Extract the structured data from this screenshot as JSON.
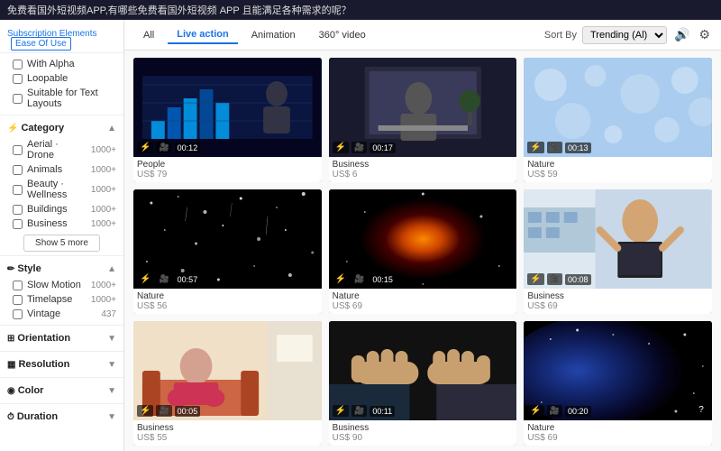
{
  "topbar": {
    "title": "免费看国外短视频APP,有哪些免费看国外短视频 APP 且能满足各种需求的呢？",
    "breadcrumb1": "Subscription Elements",
    "breadcrumb2": "Ease Of Use"
  },
  "sidebar": {
    "topLinks": [
      "With Alpha",
      "Loopable",
      "Suitable for Text Layouts"
    ],
    "sections": [
      {
        "id": "category",
        "label": "Category",
        "icon": "☰",
        "expanded": true,
        "items": [
          {
            "label": "Aerial · Drone",
            "count": "1000+"
          },
          {
            "label": "Animals",
            "count": "1000+"
          },
          {
            "label": "Beauty · Wellness",
            "count": "1000+"
          },
          {
            "label": "Buildings",
            "count": "1000+"
          },
          {
            "label": "Business",
            "count": "1000+"
          }
        ],
        "showMore": "Show 5 more"
      },
      {
        "id": "style",
        "label": "Style",
        "icon": "✏",
        "expanded": true,
        "items": [
          {
            "label": "Slow Motion",
            "count": "1000+"
          },
          {
            "label": "Timelapse",
            "count": "1000+"
          },
          {
            "label": "Vintage",
            "count": "437"
          }
        ]
      },
      {
        "id": "orientation",
        "label": "Orientation",
        "icon": "⊞",
        "expanded": false,
        "items": []
      },
      {
        "id": "resolution",
        "label": "Resolution",
        "icon": "▦",
        "expanded": false,
        "items": []
      },
      {
        "id": "color",
        "label": "Color",
        "icon": "◉",
        "expanded": false,
        "items": []
      },
      {
        "id": "duration",
        "label": "Duration",
        "icon": "⏱",
        "expanded": false,
        "items": []
      }
    ]
  },
  "filterBar": {
    "tabs": [
      {
        "id": "all",
        "label": "All",
        "active": false
      },
      {
        "id": "live-action",
        "label": "Live action",
        "active": true
      },
      {
        "id": "animation",
        "label": "Animation",
        "active": false
      },
      {
        "id": "360-video",
        "label": "360° video",
        "active": false
      }
    ],
    "sortLabel": "Sort By",
    "sortOption": "Trending (Al)",
    "iconVolume": "🔊",
    "iconSettings": "⚙"
  },
  "videos": [
    {
      "id": 1,
      "thumbType": "tech",
      "duration": "00:12",
      "hasLightning": true,
      "hasCamera": true,
      "category": "People",
      "price": "US$ 79"
    },
    {
      "id": 2,
      "thumbType": "office",
      "duration": "00:17",
      "hasLightning": true,
      "hasCamera": true,
      "category": "Business",
      "price": "US$ 6"
    },
    {
      "id": 3,
      "thumbType": "bokeh",
      "duration": "00:13",
      "hasLightning": true,
      "hasCamera": true,
      "category": "Nature",
      "price": "US$ 59"
    },
    {
      "id": 4,
      "thumbType": "space",
      "duration": "00:57",
      "hasLightning": true,
      "hasCamera": true,
      "category": "Nature",
      "price": "US$ 56"
    },
    {
      "id": 5,
      "thumbType": "galaxy",
      "duration": "00:15",
      "hasLightning": true,
      "hasCamera": true,
      "category": "Nature",
      "price": "US$ 69"
    },
    {
      "id": 6,
      "thumbType": "businessman",
      "duration": "00:08",
      "hasLightning": true,
      "hasCamera": true,
      "category": "Business",
      "price": "US$ 69"
    },
    {
      "id": 7,
      "thumbType": "sad",
      "duration": "00:05",
      "hasLightning": true,
      "hasCamera": true,
      "category": "Business",
      "price": "US$ 55"
    },
    {
      "id": 8,
      "thumbType": "handshake",
      "duration": "00:11",
      "hasLightning": true,
      "hasCamera": true,
      "category": "Business",
      "price": "US$ 90"
    },
    {
      "id": 9,
      "thumbType": "nebula",
      "duration": "00:20",
      "hasLightning": true,
      "hasCamera": true,
      "category": "Nature",
      "price": "US$ 69"
    }
  ],
  "helpBtn": "?"
}
